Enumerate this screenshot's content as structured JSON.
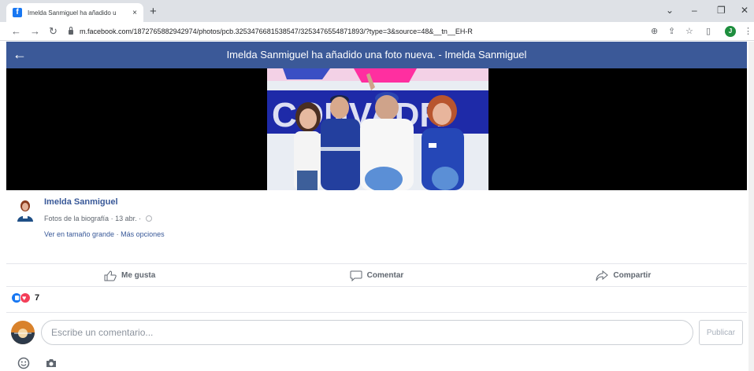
{
  "browser": {
    "tab_title": "Imelda Sanmiguel ha añadido u",
    "tab_favicon": "f",
    "tab_close": "×",
    "new_tab": "+",
    "url": "m.facebook.com/1872765882942974/photos/pcb.3253476681538547/3253476554871893/?type=3&source=48&__tn__EH-R",
    "profile_initial": "J",
    "icons": [
      "back-arrow-icon",
      "forward-arrow-icon",
      "reload-icon",
      "lock-icon",
      "zoom-icon",
      "share-icon",
      "star-icon",
      "sidebar-icon",
      "menu-icon"
    ]
  },
  "header": {
    "back_arrow": "←",
    "title": "Imelda Sanmiguel ha añadido una foto nueva. - Imelda Sanmiguel"
  },
  "post": {
    "author": "Imelda Sanmiguel",
    "album": "Fotos de la biografía",
    "date": "13 abr.",
    "separator": "·",
    "view_full": "Ver en tamaño grande",
    "more_options": "Más opciones"
  },
  "actions": {
    "like": "Me gusta",
    "comment": "Comentar",
    "share": "Compartir"
  },
  "reactions": {
    "count": "7"
  },
  "composer": {
    "placeholder": "Escribe un comentario...",
    "publish": "Publicar"
  },
  "colors": {
    "fb_blue": "#3b5998",
    "link": "#385898",
    "like_blue": "#1877f2",
    "love_red": "#f33e58"
  }
}
